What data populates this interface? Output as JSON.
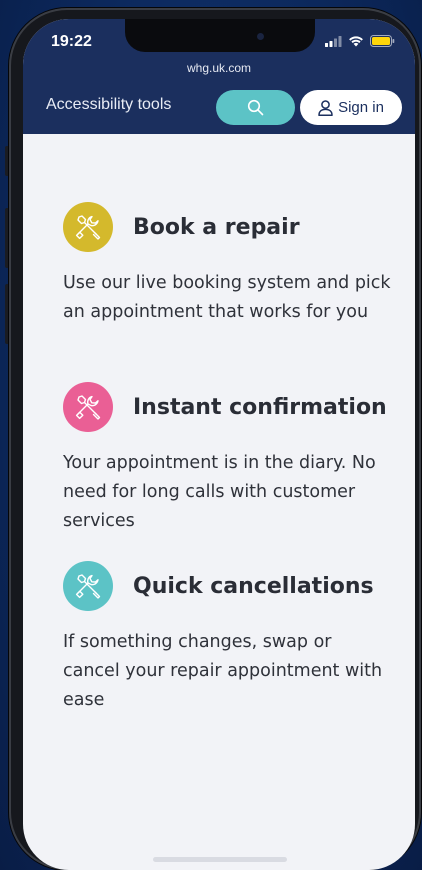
{
  "status_bar": {
    "time": "19:22"
  },
  "browser": {
    "url": "whg.uk.com"
  },
  "header": {
    "accessibility_label": "Accessibility tools",
    "signin_label": "Sign in"
  },
  "features": [
    {
      "title": "Book a repair",
      "description": "Use our live booking system and pick an appointment that works for you",
      "icon": "tools-icon",
      "color": "#d4b92c"
    },
    {
      "title": "Instant confirmation",
      "description": "Your appointment is in the diary. No need for long calls with customer services",
      "icon": "tools-icon",
      "color": "#ea5f95"
    },
    {
      "title": "Quick cancellations",
      "description": "If something changes, swap or cancel your repair appointment with ease",
      "icon": "tools-icon",
      "color": "#5cc3c6"
    }
  ],
  "colors": {
    "header_bg": "#1b2f5e",
    "accent_teal": "#5cc3c6",
    "page_bg": "#f2f3f7"
  }
}
